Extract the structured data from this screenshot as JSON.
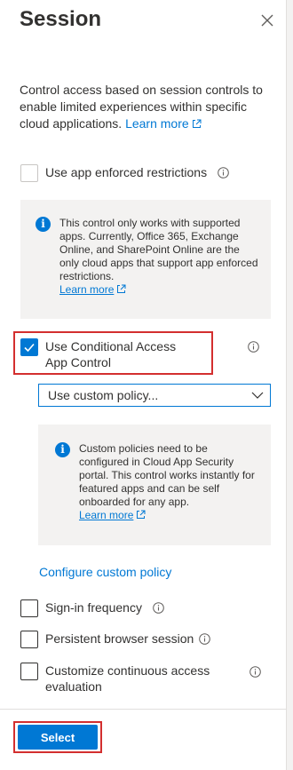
{
  "panel": {
    "title": "Session",
    "description": "Control access based on session controls to enable limited experiences within specific cloud applications.",
    "learn_more": "Learn more"
  },
  "options": {
    "app_enforced": {
      "label": "Use app enforced restrictions",
      "checked": false,
      "disabled": true
    },
    "app_enforced_info": {
      "text": "This control only works with supported apps. Currently, Office 365, Exchange Online, and SharePoint Online are the only cloud apps that support app enforced restrictions.",
      "learn_more": "Learn more"
    },
    "cond_access": {
      "label": "Use Conditional Access App Control",
      "checked": true
    },
    "policy_select": {
      "value": "Use custom policy..."
    },
    "custom_info": {
      "text": "Custom policies need to be configured in Cloud App Security portal. This control works instantly for featured apps and can be self onboarded for any app.",
      "learn_more": "Learn more"
    },
    "configure_link": "Configure custom policy",
    "signin_freq": {
      "label": "Sign-in frequency",
      "checked": false
    },
    "persistent": {
      "label": "Persistent browser session",
      "checked": false
    },
    "continuous": {
      "label": "Customize continuous access evaluation",
      "checked": false
    }
  },
  "footer": {
    "select_label": "Select"
  },
  "colors": {
    "accent": "#0078d4",
    "highlight": "#d32f2f",
    "info_bg": "#f3f2f1"
  },
  "icons": [
    "close-icon",
    "info-icon",
    "external-link-icon",
    "chevron-down-icon",
    "checkmark-icon"
  ]
}
